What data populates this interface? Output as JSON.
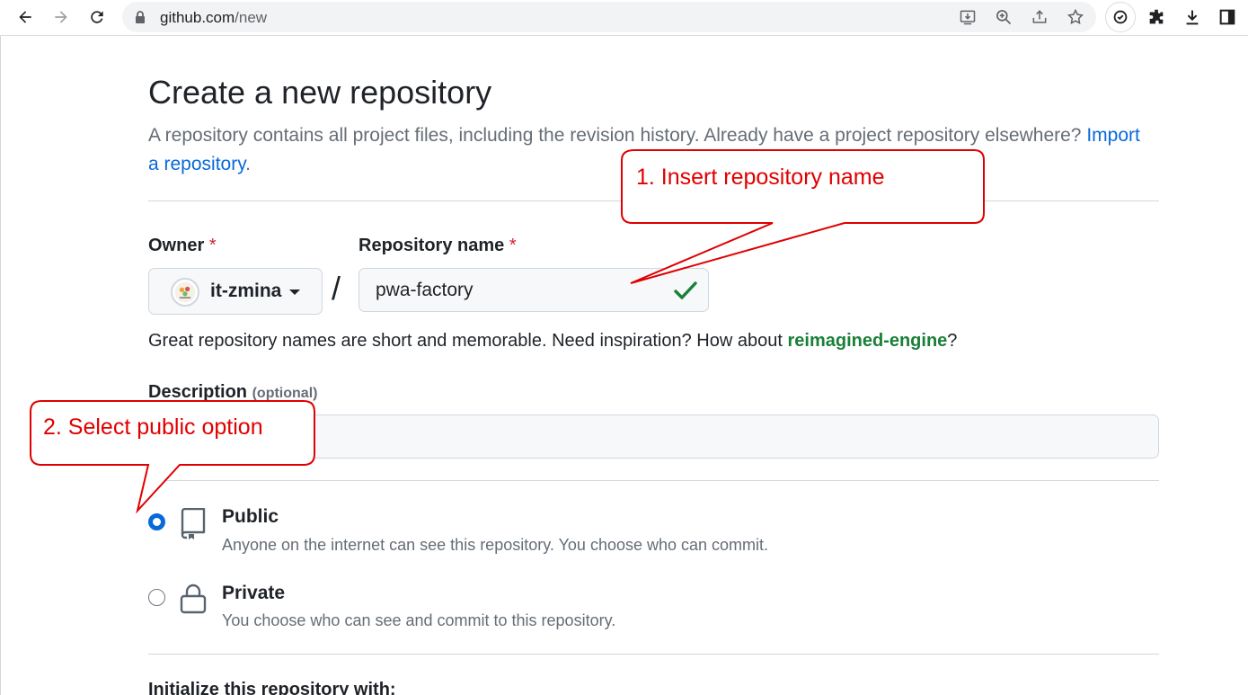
{
  "browser": {
    "url_host": "github.com",
    "url_path": "/new"
  },
  "page": {
    "title": "Create a new repository",
    "subtitle": "A repository contains all project files, including the revision history. Already have a project repository elsewhere?",
    "import_link": "Import a repository",
    "import_suffix": "."
  },
  "owner": {
    "label": "Owner",
    "required_mark": "*",
    "value": "it-zmina"
  },
  "repo_name": {
    "label": "Repository name",
    "required_mark": "*",
    "value": "pwa-factory",
    "separator": "/"
  },
  "hint": {
    "text": "Great repository names are short and memorable. Need inspiration? How about ",
    "suggestion": "reimagined-engine",
    "suffix": "?"
  },
  "description": {
    "label": "Description",
    "optional": "(optional)",
    "value": ""
  },
  "visibility": {
    "selected": "public",
    "options": [
      {
        "title": "Public",
        "description": "Anyone on the internet can see this repository. You choose who can commit."
      },
      {
        "title": "Private",
        "description": "You choose who can see and commit to this repository."
      }
    ]
  },
  "initialize": {
    "heading": "Initialize this repository with:"
  },
  "annotations": {
    "step1": "1. Insert repository name",
    "step2": "2. Select public option",
    "color": "#e00000"
  },
  "colors": {
    "link": "#0969da",
    "success": "#1a7f37",
    "required": "#cf222e",
    "muted": "#656d76"
  }
}
